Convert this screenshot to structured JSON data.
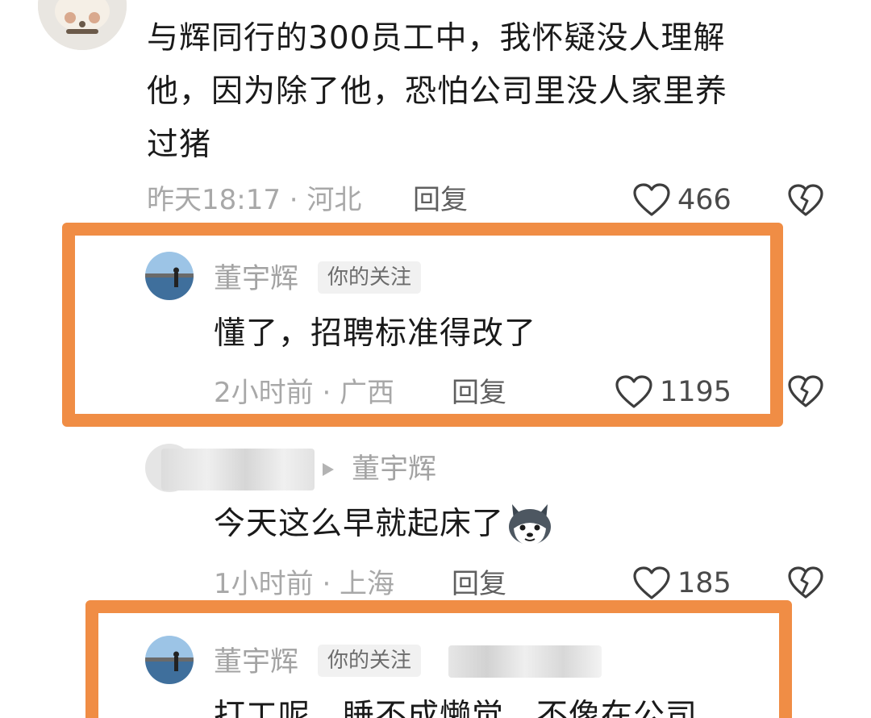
{
  "colors": {
    "highlight": "#f08d45",
    "main_text": "#1a1a1a",
    "meta_text": "#a8a8a8",
    "username": "#a3a3a3"
  },
  "comments": [
    {
      "text_lines": [
        "与辉同行的300员工中，我怀疑没人理解",
        "他，因为除了他，恐怕公司里没人家里养",
        "过猪"
      ],
      "meta": "昨天18:17 · 河北",
      "reply_label": "回复",
      "likes": "466",
      "avatar_icon": "pet-avatar-icon"
    }
  ],
  "replies": [
    {
      "username": "董宇辉",
      "badge": "你的关注",
      "text": "懂了，招聘标准得改了",
      "meta": "2小时前 · 广西",
      "reply_label": "回复",
      "likes": "1195",
      "highlighted": true
    },
    {
      "username_redacted": true,
      "reply_to": "董宇辉",
      "text": "今天这么早就起床了",
      "emoji": "husky-emoji-icon",
      "meta": "1小时前 · 上海",
      "reply_label": "回复",
      "likes": "185",
      "highlighted": false
    },
    {
      "username": "董宇辉",
      "badge": "你的关注",
      "text": "打工呢，睡不成懒觉，不像在公司",
      "highlighted": true
    }
  ]
}
